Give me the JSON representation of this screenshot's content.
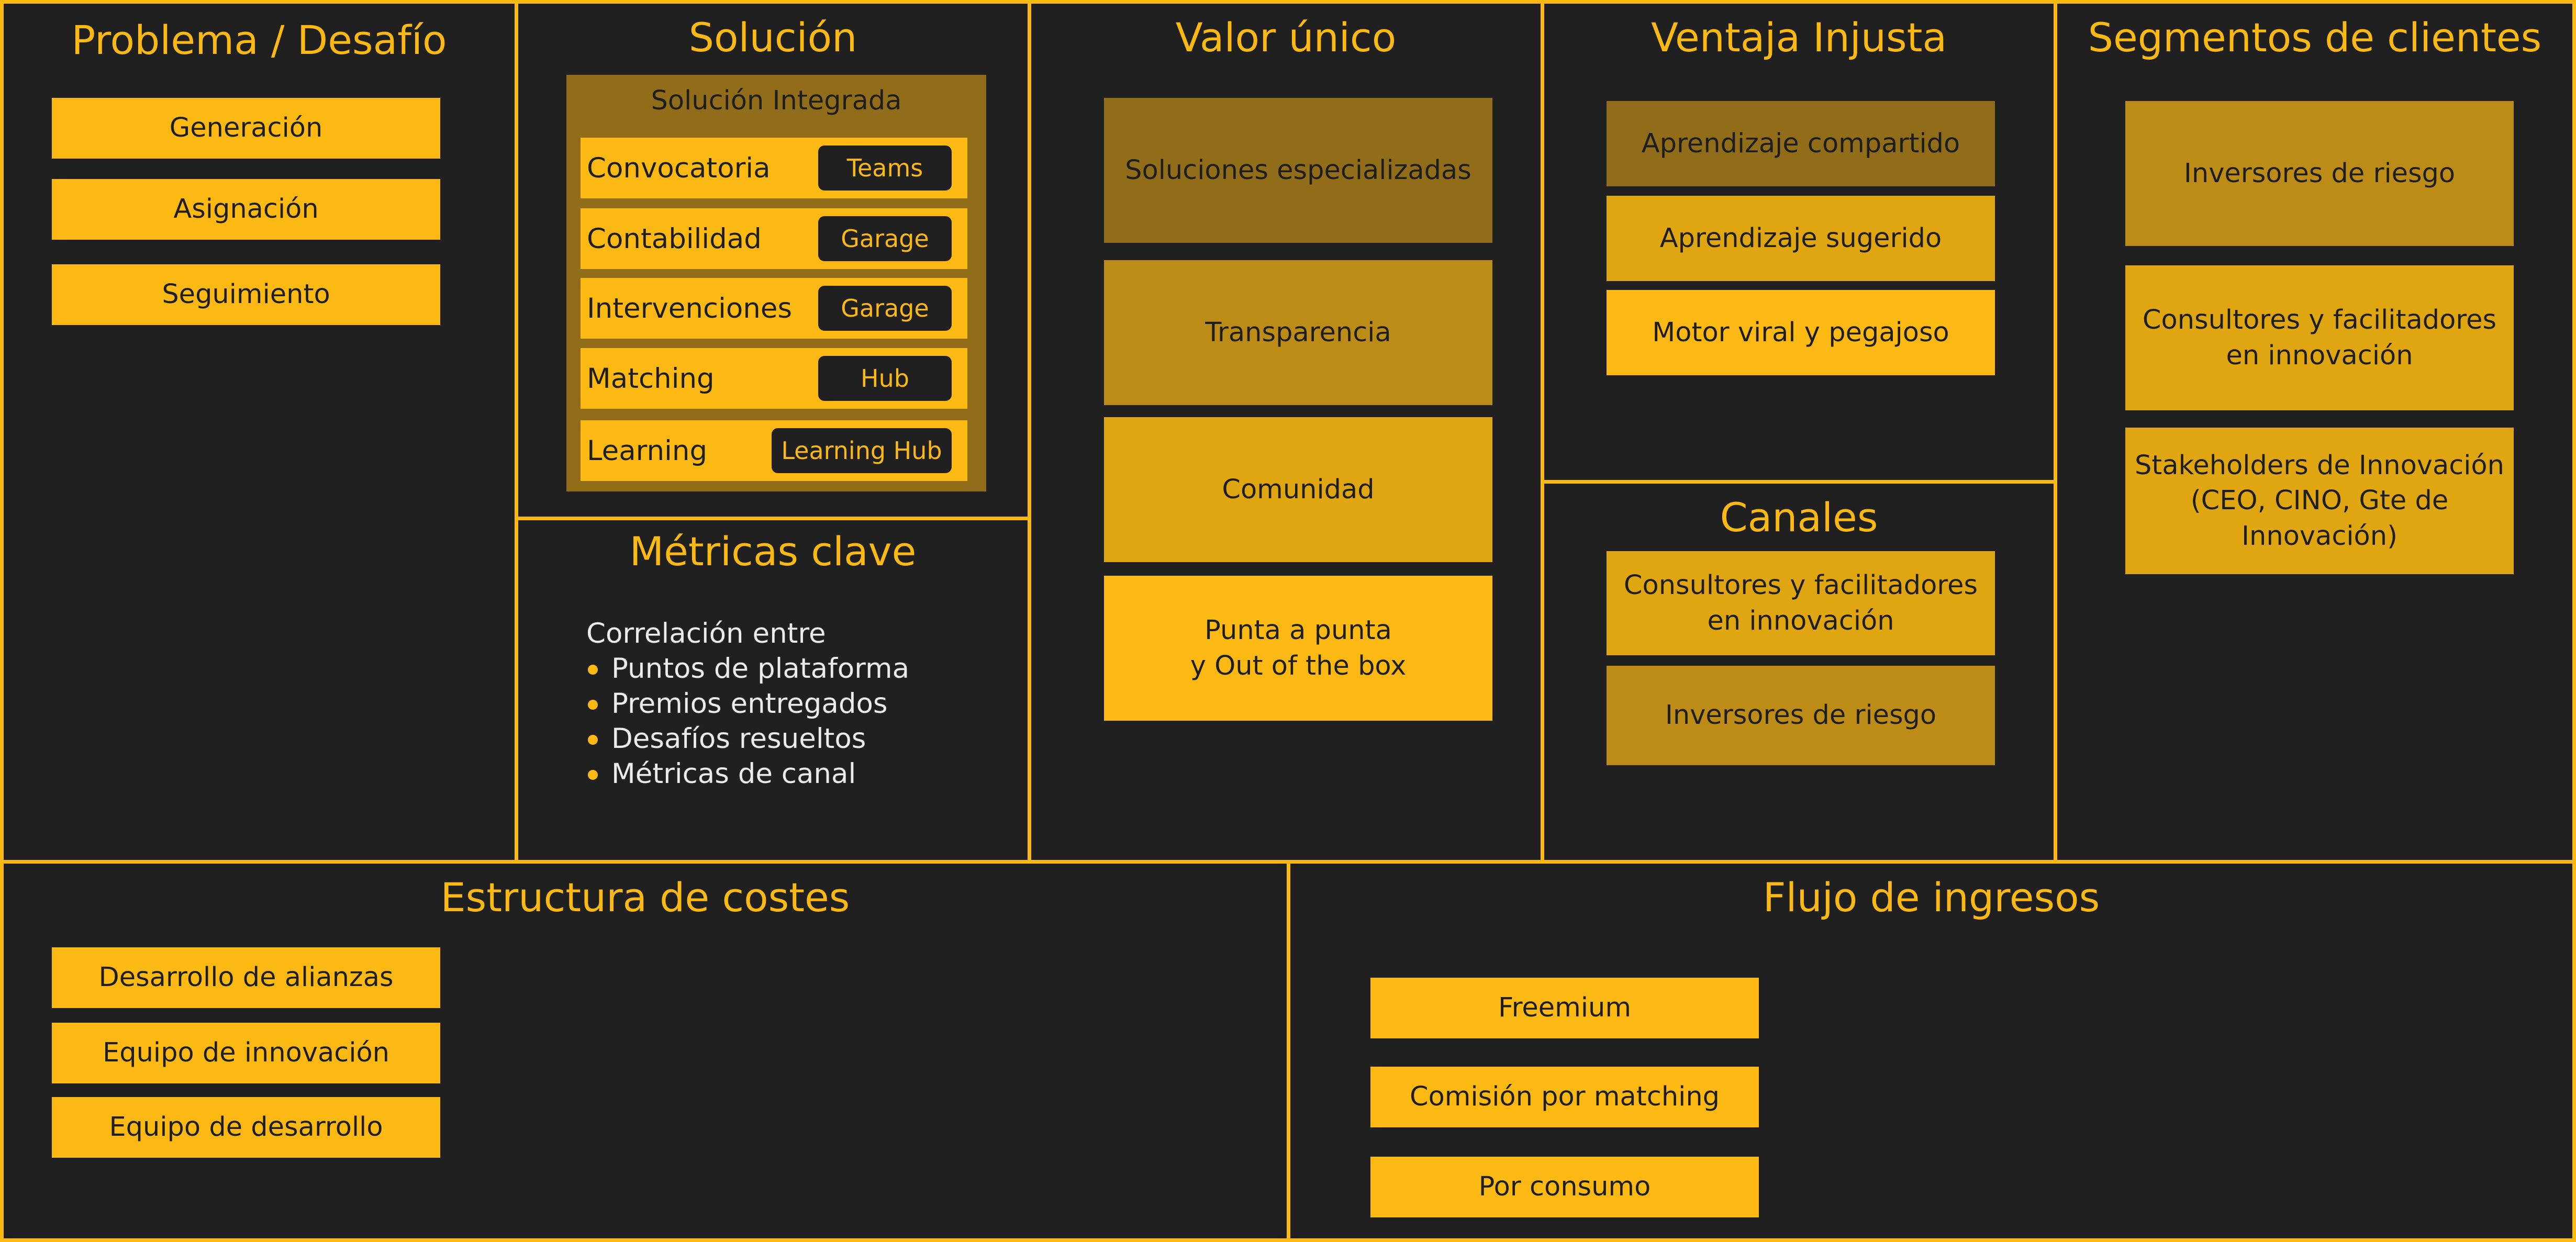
{
  "canvas": {
    "problem": {
      "title": "Problema / Desafío",
      "items": [
        "Generación",
        "Asignación",
        "Seguimiento"
      ]
    },
    "solution": {
      "title": "Solución",
      "panel_title": "Solución Integrada",
      "rows": [
        {
          "label": "Convocatoria",
          "tag": "Teams"
        },
        {
          "label": "Contabilidad",
          "tag": "Garage"
        },
        {
          "label": "Intervenciones",
          "tag": "Garage"
        },
        {
          "label": "Matching",
          "tag": "Hub"
        },
        {
          "label": "Learning",
          "tag": "Learning Hub"
        }
      ]
    },
    "key_metrics": {
      "title": "Métricas clave",
      "intro": "Correlación entre",
      "items": [
        "Puntos de plataforma",
        "Premios entregados",
        "Desafíos resueltos",
        "Métricas de canal"
      ]
    },
    "unique_value": {
      "title": "Valor único",
      "items": [
        "Soluciones especializadas",
        "Transparencia",
        "Comunidad",
        "Punta a punta\ny Out of the box"
      ]
    },
    "unfair_advantage": {
      "title": "Ventaja Injusta",
      "items": [
        "Aprendizaje compartido",
        "Aprendizaje sugerido",
        "Motor viral y pegajoso"
      ]
    },
    "channels": {
      "title": "Canales",
      "items": [
        "Consultores y facilitadores\nen innovación",
        "Inversores de riesgo"
      ]
    },
    "customer_segments": {
      "title": "Segmentos de clientes",
      "items": [
        "Inversores de riesgo",
        "Consultores y facilitadores\nen innovación",
        "Stakeholders de Innovación\n(CEO, CINO, Gte de\nInnovación)"
      ]
    },
    "cost_structure": {
      "title": "Estructura de costes",
      "items": [
        "Desarrollo de alianzas",
        "Equipo de innovación",
        "Equipo de desarrollo"
      ]
    },
    "revenue_streams": {
      "title": "Flujo de ingresos",
      "items": [
        "Freemium",
        "Comisión por matching",
        "Por consumo"
      ]
    }
  },
  "colors": {
    "accent": "#fdb913",
    "background": "#202020",
    "box_mid": "#e0a612",
    "box_dim": "#bd8c16",
    "box_dark": "#916c19",
    "metric_text": "#ececec"
  }
}
